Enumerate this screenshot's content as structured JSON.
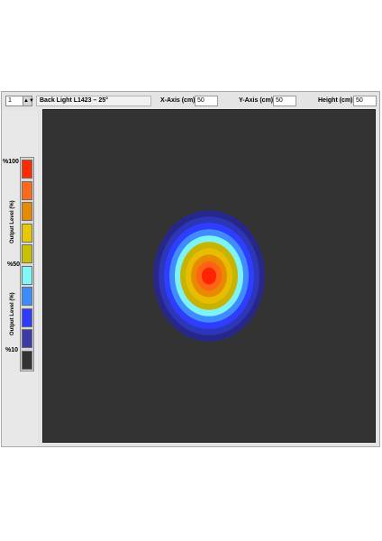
{
  "toolbar": {
    "index_value": "1",
    "index_button": "▲▼",
    "product_title": "Back Light L1423 – 25°",
    "x_axis_label": "X-Axis (cm)",
    "x_axis_value": "50",
    "y_axis_label": "Y-Axis (cm)",
    "y_axis_value": "50",
    "height_label": "Height (cm)",
    "height_value": "50"
  },
  "scale": {
    "top_label": "%100",
    "mid_label": "%50",
    "bottom_label": "%10",
    "axis_title_upper": "Output Level (%)",
    "axis_title_lower": "Output Level (%)",
    "swatches": [
      "#ff2a00",
      "#ff6a1a",
      "#e88a00",
      "#e8c800",
      "#c8c000",
      "#7ff8f8",
      "#3b8cff",
      "#2e3cff",
      "#3a3aa8",
      "#333333"
    ]
  },
  "plot": {
    "background": "#333333",
    "rings": [
      {
        "color": "#27278a",
        "level": 10
      },
      {
        "color": "#2b36b8",
        "level": 20
      },
      {
        "color": "#2f3dff",
        "level": 30
      },
      {
        "color": "#3f8cff",
        "level": 40
      },
      {
        "color": "#7df3f3",
        "level": 50
      },
      {
        "color": "#c8b400",
        "level": 60
      },
      {
        "color": "#e6bd00",
        "level": 70
      },
      {
        "color": "#e78a00",
        "level": 80
      },
      {
        "color": "#ff6318",
        "level": 90
      },
      {
        "color": "#ff2400",
        "level": 100
      }
    ]
  }
}
